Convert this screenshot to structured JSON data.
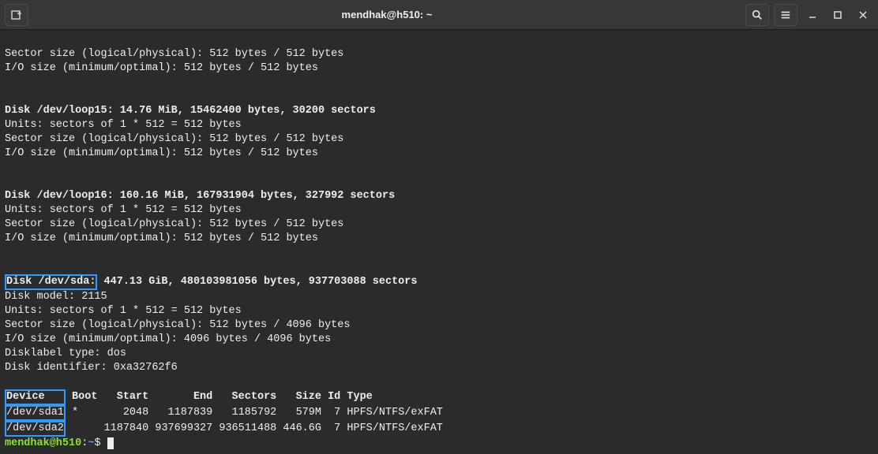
{
  "title": "mendhak@h510: ~",
  "lines": {
    "sector_a": "Sector size (logical/physical): 512 bytes / 512 bytes",
    "io_a": "I/O size (minimum/optimal): 512 bytes / 512 bytes",
    "disk15_header": "Disk /dev/loop15: 14.76 MiB, 15462400 bytes, 30200 sectors",
    "units15": "Units: sectors of 1 * 512 = 512 bytes",
    "sector15": "Sector size (logical/physical): 512 bytes / 512 bytes",
    "io15": "I/O size (minimum/optimal): 512 bytes / 512 bytes",
    "disk16_header": "Disk /dev/loop16: 160.16 MiB, 167931904 bytes, 327992 sectors",
    "units16": "Units: sectors of 1 * 512 = 512 bytes",
    "sector16": "Sector size (logical/physical): 512 bytes / 512 bytes",
    "io16": "I/O size (minimum/optimal): 512 bytes / 512 bytes",
    "sda_label": "Disk /dev/sda:",
    "sda_rest": " 447.13 GiB, 480103981056 bytes, 937703088 sectors",
    "model": "Disk model: 2115",
    "units_sda": "Units: sectors of 1 * 512 = 512 bytes",
    "sector_sda": "Sector size (logical/physical): 512 bytes / 4096 bytes",
    "io_sda": "I/O size (minimum/optimal): 4096 bytes / 4096 bytes",
    "disklabel": "Disklabel type: dos",
    "diskid": "Disk identifier: 0xa32762f6",
    "table_header_device": "Device   ",
    "table_header_rest": " Boot   Start       End   Sectors   Size Id Type",
    "row1_device": "/dev/sda1",
    "row1_rest": " *       2048   1187839   1185792   579M  7 HPFS/NTFS/exFAT",
    "row2_device": "/dev/sda2",
    "row2_rest": "      1187840 937699327 936511488 446.6G  7 HPFS/NTFS/exFAT",
    "prompt_user": "mendhak@h510",
    "prompt_colon": ":",
    "prompt_path": "~",
    "prompt_dollar": "$ "
  }
}
